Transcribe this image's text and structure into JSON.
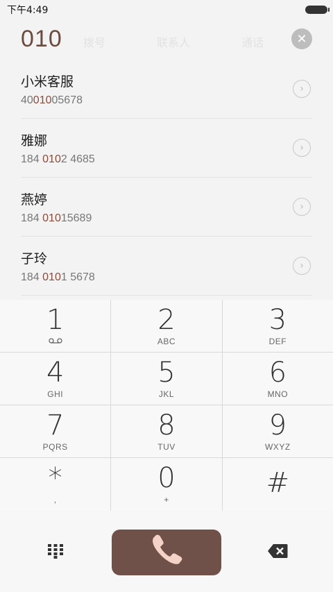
{
  "status_bar": {
    "time": "下午4:49"
  },
  "dialer": {
    "dialed_number": "010",
    "clear_icon": "clear-icon",
    "background_tabs": [
      "拨号",
      "联系人",
      "通话"
    ]
  },
  "results": [
    {
      "name": "小米客服",
      "num_pre": "40",
      "num_hl": "010",
      "num_post": "05678"
    },
    {
      "name": "雅娜",
      "num_pre": "184 ",
      "num_hl": "010",
      "num_post": "2 4685"
    },
    {
      "name": "燕婷",
      "num_pre": "184 ",
      "num_hl": "010",
      "num_post": "15689"
    },
    {
      "name": "子玲",
      "num_pre": "184 ",
      "num_hl": "010",
      "num_post": "1 5678"
    }
  ],
  "keypad": [
    {
      "digit": "1",
      "letters": ""
    },
    {
      "digit": "2",
      "letters": "ABC"
    },
    {
      "digit": "3",
      "letters": "DEF"
    },
    {
      "digit": "4",
      "letters": "GHI"
    },
    {
      "digit": "5",
      "letters": "JKL"
    },
    {
      "digit": "6",
      "letters": "MNO"
    },
    {
      "digit": "7",
      "letters": "PQRS"
    },
    {
      "digit": "8",
      "letters": "TUV"
    },
    {
      "digit": "9",
      "letters": "WXYZ"
    },
    {
      "digit": "*",
      "letters": ","
    },
    {
      "digit": "0",
      "letters": "+"
    },
    {
      "digit": "#",
      "letters": ""
    }
  ],
  "colors": {
    "accent": "#6f5149",
    "highlight": "#8a4b3a",
    "call_icon": "#f5d2c8"
  }
}
